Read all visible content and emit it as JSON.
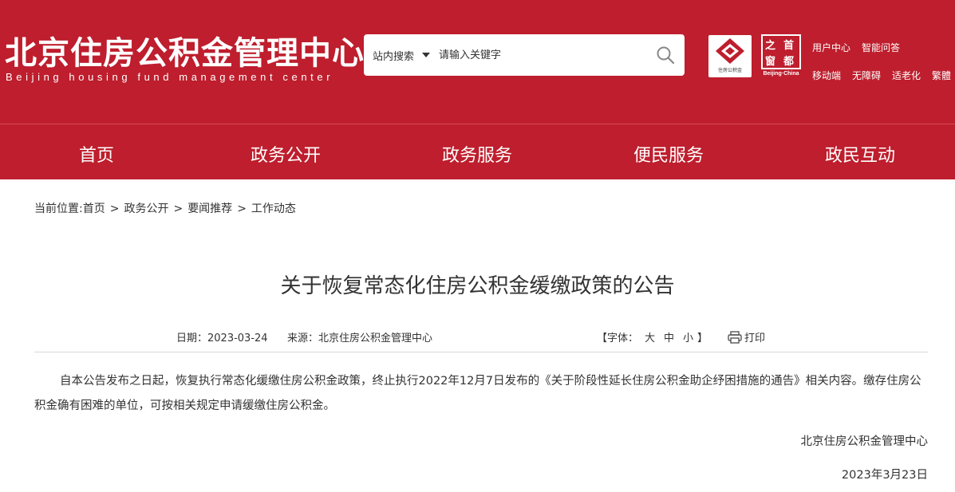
{
  "header": {
    "site_title": "北京住房公积金管理中心",
    "site_subtitle": "Beijing housing fund management center",
    "search_scope": "站内搜索",
    "search_placeholder": "请输入关键字",
    "logo1_text": "住房公积金",
    "logo2_chars": [
      "之",
      "首",
      "窗",
      "都"
    ],
    "logo2_caption": "Beijing·China",
    "links_row1": [
      "用户中心",
      "智能问答"
    ],
    "links_row2": [
      "移动端",
      "无障碍",
      "适老化",
      "繁體"
    ]
  },
  "nav": {
    "items": [
      "首页",
      "政务公开",
      "政务服务",
      "便民服务",
      "政民互动"
    ]
  },
  "breadcrumb": {
    "prefix": "当前位置:",
    "items": [
      "首页",
      "政务公开",
      "要闻推荐",
      "工作动态"
    ],
    "separator": ">"
  },
  "article": {
    "title": "关于恢复常态化住房公积金缓缴政策的公告",
    "date": "日期：2023-03-24",
    "source": "来源：北京住房公积金管理中心",
    "font_label_open": "【字体：",
    "font_sizes": [
      "大",
      "中",
      "小"
    ],
    "font_label_close": "】",
    "print_label": "打印",
    "body": "自本公告发布之日起，恢复执行常态化缓缴住房公积金政策，终止执行2022年12月7日发布的《关于阶段性延长住房公积金助企纾困措施的通告》相关内容。缴存住房公积金确有困难的单位，可按相关规定申请缓缴住房公积金。",
    "signoff_org": "北京住房公积金管理中心",
    "signoff_date": "2023年3月23日"
  },
  "colors": {
    "brand_red": "#be1e2d",
    "text": "#333333",
    "divider": "#d9d9d9"
  },
  "icons": [
    "search-icon",
    "dropdown-arrow-icon",
    "printer-icon",
    "housing-fund-logo",
    "beijing-seal-logo"
  ]
}
